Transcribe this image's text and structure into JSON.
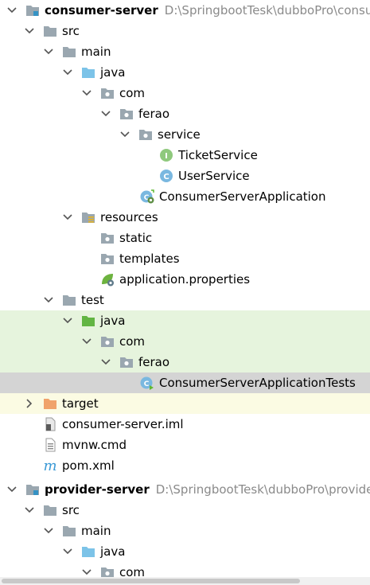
{
  "tree": {
    "rows": [
      {
        "label": "consumer-server",
        "path": "D:\\SpringbootTesk\\dubboPro\\consum",
        "icon": "module-folder-icon",
        "arrow": "down",
        "bold": true
      },
      {
        "label": "src",
        "icon": "folder-icon",
        "arrow": "down"
      },
      {
        "label": "main",
        "icon": "folder-icon",
        "arrow": "down"
      },
      {
        "label": "java",
        "icon": "source-folder-icon",
        "arrow": "down"
      },
      {
        "label": "com",
        "icon": "package-icon",
        "arrow": "down"
      },
      {
        "label": "ferao",
        "icon": "package-icon",
        "arrow": "down"
      },
      {
        "label": "service",
        "icon": "package-icon",
        "arrow": "down"
      },
      {
        "label": "TicketService",
        "icon": "interface-icon",
        "arrow": "none"
      },
      {
        "label": "UserService",
        "icon": "class-icon",
        "arrow": "none"
      },
      {
        "label": "ConsumerServerApplication",
        "icon": "spring-boot-class-icon",
        "arrow": "none"
      },
      {
        "label": "resources",
        "icon": "resources-folder-icon",
        "arrow": "down"
      },
      {
        "label": "static",
        "icon": "package-icon",
        "arrow": "none"
      },
      {
        "label": "templates",
        "icon": "package-icon",
        "arrow": "none"
      },
      {
        "label": "application.properties",
        "icon": "spring-properties-icon",
        "arrow": "none"
      },
      {
        "label": "test",
        "icon": "folder-icon",
        "arrow": "down"
      },
      {
        "label": "java",
        "icon": "test-folder-icon",
        "arrow": "down"
      },
      {
        "label": "com",
        "icon": "package-icon",
        "arrow": "down"
      },
      {
        "label": "ferao",
        "icon": "package-icon",
        "arrow": "down"
      },
      {
        "label": "ConsumerServerApplicationTests",
        "icon": "test-class-icon",
        "arrow": "none"
      },
      {
        "label": "target",
        "icon": "excluded-folder-icon",
        "arrow": "right"
      },
      {
        "label": "consumer-server.iml",
        "icon": "iml-file-icon",
        "arrow": "none"
      },
      {
        "label": "mvnw.cmd",
        "icon": "text-file-icon",
        "arrow": "none"
      },
      {
        "label": "pom.xml",
        "icon": "maven-icon",
        "arrow": "none"
      },
      {
        "label": "provider-server",
        "path": "D:\\SpringbootTesk\\dubboPro\\provider-",
        "icon": "module-folder-icon",
        "arrow": "down",
        "bold": true
      },
      {
        "label": "src",
        "icon": "folder-icon",
        "arrow": "down"
      },
      {
        "label": "main",
        "icon": "folder-icon",
        "arrow": "down"
      },
      {
        "label": "java",
        "icon": "source-folder-icon",
        "arrow": "down"
      },
      {
        "label": "com",
        "icon": "package-icon",
        "arrow": "down"
      }
    ]
  },
  "colors": {
    "test_bg": "#e6f4dd",
    "selected_bg": "#d4d4d4",
    "excluded_bg": "#fbfbe3",
    "path_text": "#8a8a8a"
  }
}
